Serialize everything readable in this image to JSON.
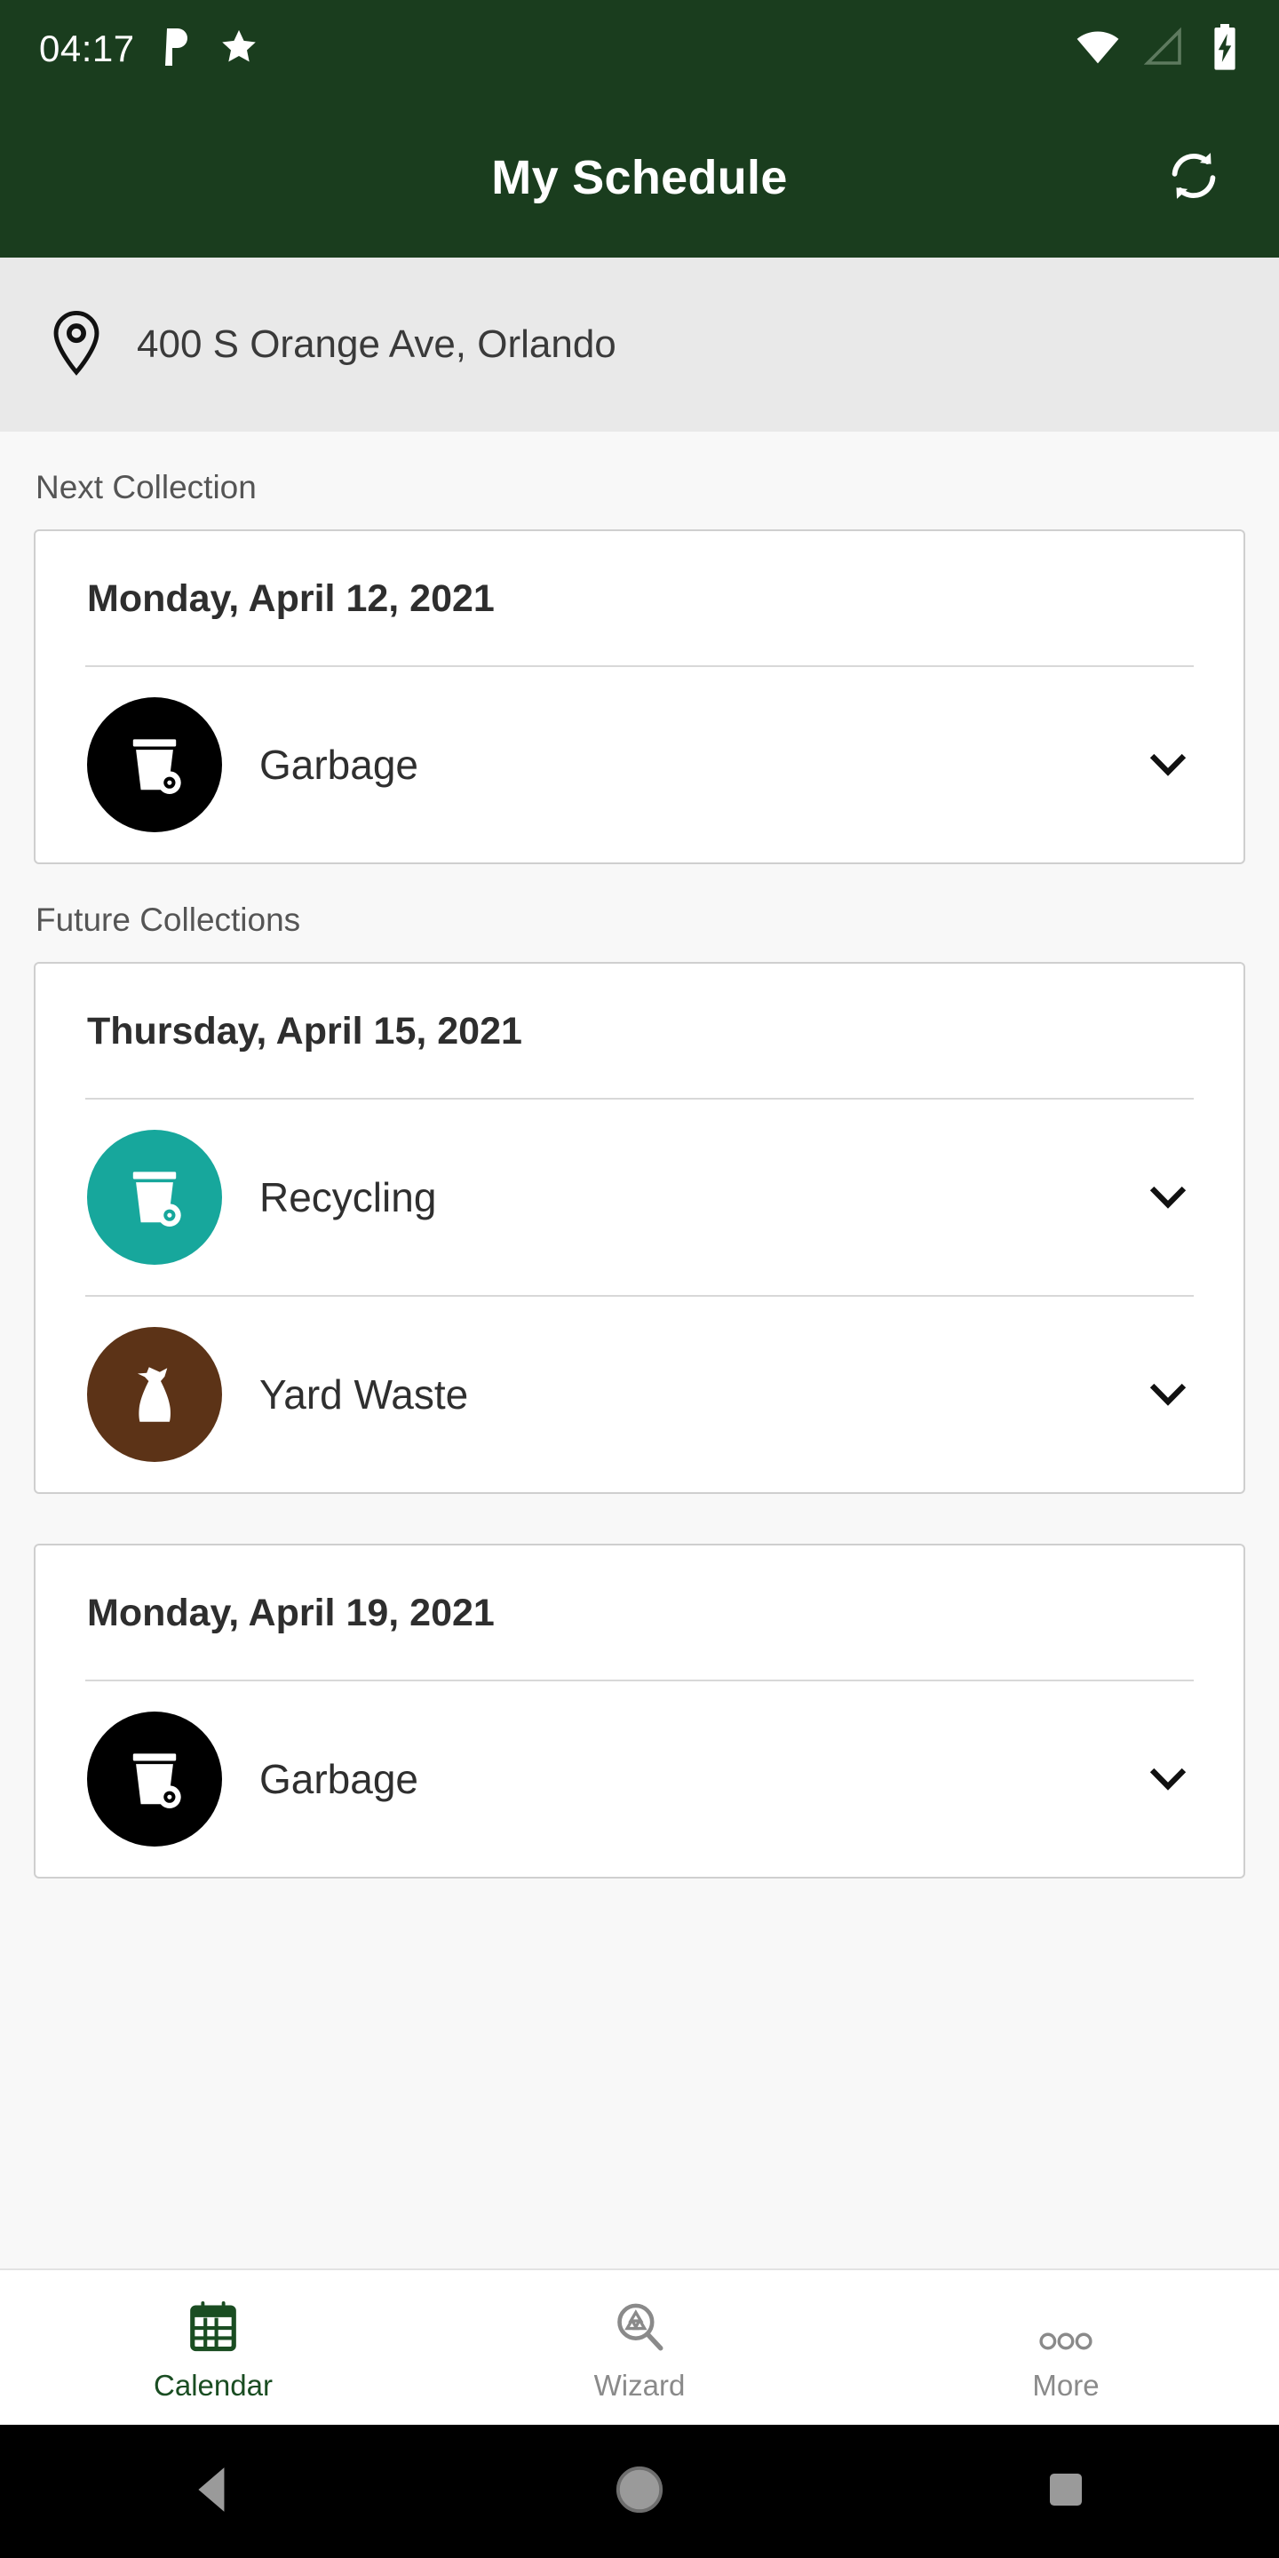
{
  "status_bar": {
    "time": "04:17",
    "icons_left": [
      "parking-p-icon",
      "star-icon"
    ],
    "icons_right": [
      "wifi-icon",
      "cell-signal-icon",
      "battery-charging-icon"
    ],
    "background_color": "#1A3D1E"
  },
  "app_bar": {
    "title": "My Schedule",
    "action_icon": "refresh-icon",
    "background_color": "#1A3D1E",
    "title_color": "#FFFFFF"
  },
  "address_bar": {
    "icon": "location-pin-icon",
    "address": "400 S Orange Ave, Orlando",
    "background_color": "#E9E9E9"
  },
  "sections": [
    {
      "label": "Next Collection",
      "cards": [
        {
          "date": "Monday, April 12, 2021",
          "items": [
            {
              "name": "Garbage",
              "icon": "garbage-cart-icon",
              "color": "#000000",
              "expander": "chevron-down-icon"
            }
          ]
        }
      ]
    },
    {
      "label": "Future Collections",
      "cards": [
        {
          "date": "Thursday, April 15, 2021",
          "items": [
            {
              "name": "Recycling",
              "icon": "recycling-cart-icon",
              "color": "#17A79C",
              "expander": "chevron-down-icon"
            },
            {
              "name": "Yard Waste",
              "icon": "yard-waste-bag-icon",
              "color": "#5C3317",
              "expander": "chevron-down-icon"
            }
          ]
        },
        {
          "date": "Monday, April 19, 2021",
          "items": [
            {
              "name": "Garbage",
              "icon": "garbage-cart-icon",
              "color": "#000000",
              "expander": "chevron-down-icon"
            }
          ]
        }
      ]
    }
  ],
  "tab_bar": {
    "active_color": "#1A4D22",
    "inactive_color": "#8A8A8A",
    "tabs": [
      {
        "label": "Calendar",
        "icon": "calendar-icon",
        "active": true
      },
      {
        "label": "Wizard",
        "icon": "recycle-search-icon",
        "active": false
      },
      {
        "label": "More",
        "icon": "more-dots-icon",
        "active": false
      }
    ]
  },
  "android_nav": {
    "buttons": [
      {
        "name": "back-button",
        "icon": "triangle-back-icon"
      },
      {
        "name": "home-button",
        "icon": "circle-home-icon"
      },
      {
        "name": "recents-button",
        "icon": "square-recents-icon"
      }
    ]
  }
}
